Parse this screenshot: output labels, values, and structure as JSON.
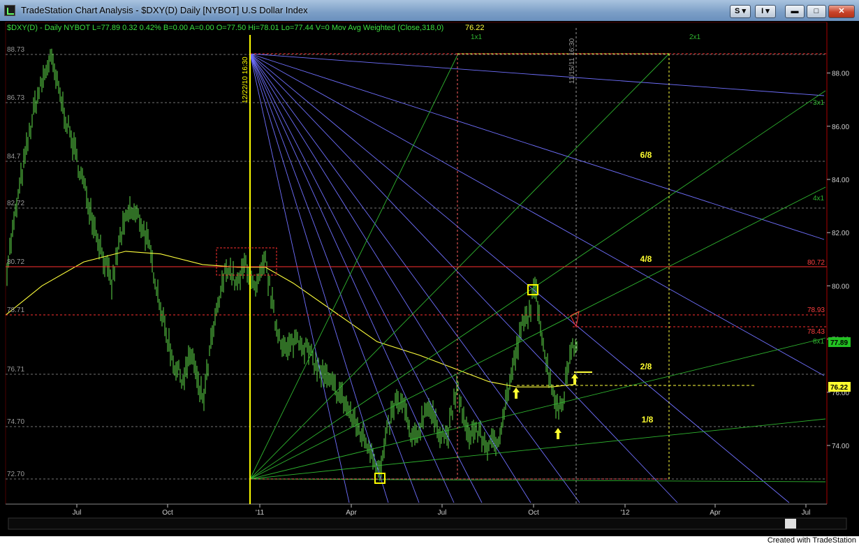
{
  "window": {
    "title": "TradeStation Chart Analysis - $DXY(D) Daily [NYBOT] U.S Dollar Index",
    "btn_s": "S",
    "btn_i": "I"
  },
  "chart": {
    "header": "$DXY(D) - Daily  NYBOT  L=77.89  0.32  0.42%  B=0.00  A=0.00  O=77.50  Hi=78.01  Lo=77.44  V=0  Mov Avg Weighted (Close,318,0)",
    "header_ma_value": "76.22",
    "left_levels": [
      "88.73",
      "86.73",
      "84.7",
      "82.72",
      "80.72",
      "78.71",
      "76.71",
      "74.70",
      "72.70"
    ],
    "right_axis_ticks": [
      "88.00",
      "86.00",
      "84.00",
      "82.00",
      "80.00",
      "78.00",
      "76.00",
      "74.00"
    ],
    "right_level_labels": [
      "80.72",
      "78.93",
      "78.43"
    ],
    "price_tag": "77.89",
    "ma_tag": "76.22",
    "x_axis_labels": [
      "Jul",
      "Oct",
      "'11",
      "Apr",
      "Jul",
      "Oct",
      "'12",
      "Apr",
      "Jul"
    ],
    "octave_labels": [
      "6/8",
      "4/8",
      "2/8",
      "1/8"
    ],
    "fan_labels": [
      "1x1",
      "2x1",
      "3x1",
      "4x1",
      "8x1"
    ],
    "vline_labels": [
      "12/22/10 16:30",
      "11/15/11 16:30"
    ],
    "colors": {
      "background": "#000000",
      "bars": "#5fdc4a",
      "moving_average": "#ffff3c",
      "gann_fan_top": "#7070ff",
      "gann_fan_bottom": "#2fb52f",
      "levels": "#ff3030"
    }
  },
  "footer": {
    "credit": "Created with TradeStation"
  }
}
